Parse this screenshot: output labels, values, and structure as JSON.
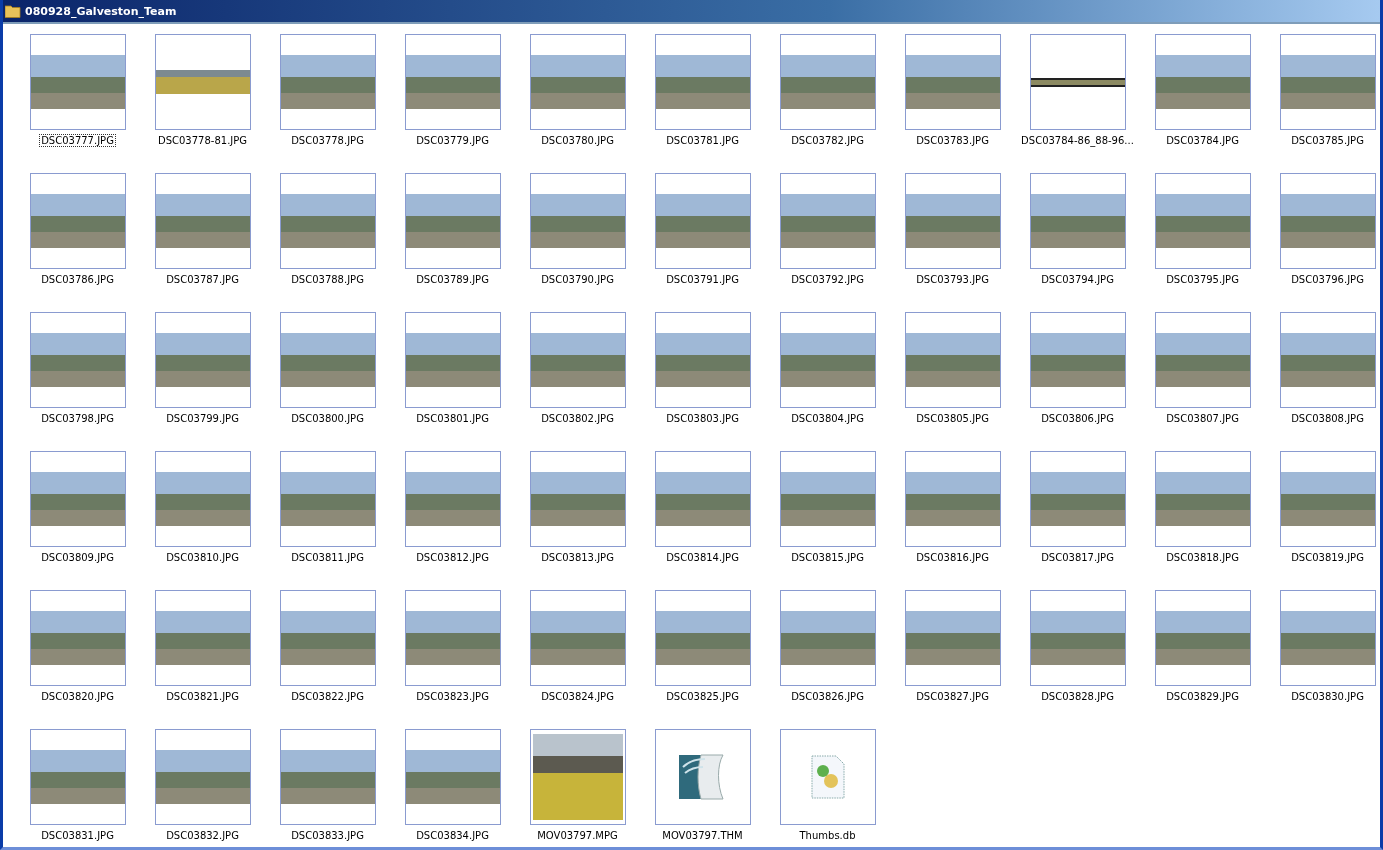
{
  "window": {
    "title": "080928_Galveston_Team"
  },
  "items": [
    {
      "name": "DSC03777.JPG",
      "kind": "photo",
      "focused": true
    },
    {
      "name": "DSC03778-81.JPG",
      "kind": "wide",
      "focused": false
    },
    {
      "name": "DSC03778.JPG",
      "kind": "photo",
      "focused": false
    },
    {
      "name": "DSC03779.JPG",
      "kind": "photo",
      "focused": false
    },
    {
      "name": "DSC03780.JPG",
      "kind": "photo",
      "focused": false
    },
    {
      "name": "DSC03781.JPG",
      "kind": "photo",
      "focused": false
    },
    {
      "name": "DSC03782.JPG",
      "kind": "photo",
      "focused": false
    },
    {
      "name": "DSC03783.JPG",
      "kind": "photo",
      "focused": false
    },
    {
      "name": "DSC03784-86_88-96...",
      "kind": "panorama",
      "focused": false
    },
    {
      "name": "DSC03784.JPG",
      "kind": "photo",
      "focused": false
    },
    {
      "name": "DSC03785.JPG",
      "kind": "photo",
      "focused": false
    },
    {
      "name": "DSC03786.JPG",
      "kind": "photo",
      "focused": false
    },
    {
      "name": "DSC03787.JPG",
      "kind": "photo",
      "focused": false
    },
    {
      "name": "DSC03788.JPG",
      "kind": "photo",
      "focused": false
    },
    {
      "name": "DSC03789.JPG",
      "kind": "photo",
      "focused": false
    },
    {
      "name": "DSC03790.JPG",
      "kind": "photo",
      "focused": false
    },
    {
      "name": "DSC03791.JPG",
      "kind": "photo",
      "focused": false
    },
    {
      "name": "DSC03792.JPG",
      "kind": "photo",
      "focused": false
    },
    {
      "name": "DSC03793.JPG",
      "kind": "photo",
      "focused": false
    },
    {
      "name": "DSC03794.JPG",
      "kind": "photo",
      "focused": false
    },
    {
      "name": "DSC03795.JPG",
      "kind": "photo",
      "focused": false
    },
    {
      "name": "DSC03796.JPG",
      "kind": "photo",
      "focused": false
    },
    {
      "name": "DSC03798.JPG",
      "kind": "photo",
      "focused": false
    },
    {
      "name": "DSC03799.JPG",
      "kind": "photo",
      "focused": false
    },
    {
      "name": "DSC03800.JPG",
      "kind": "photo",
      "focused": false
    },
    {
      "name": "DSC03801.JPG",
      "kind": "photo",
      "focused": false
    },
    {
      "name": "DSC03802.JPG",
      "kind": "photo",
      "focused": false
    },
    {
      "name": "DSC03803.JPG",
      "kind": "photo",
      "focused": false
    },
    {
      "name": "DSC03804.JPG",
      "kind": "photo",
      "focused": false
    },
    {
      "name": "DSC03805.JPG",
      "kind": "photo",
      "focused": false
    },
    {
      "name": "DSC03806.JPG",
      "kind": "photo",
      "focused": false
    },
    {
      "name": "DSC03807.JPG",
      "kind": "photo",
      "focused": false
    },
    {
      "name": "DSC03808.JPG",
      "kind": "photo",
      "focused": false
    },
    {
      "name": "DSC03809.JPG",
      "kind": "photo",
      "focused": false
    },
    {
      "name": "DSC03810.JPG",
      "kind": "photo",
      "focused": false
    },
    {
      "name": "DSC03811.JPG",
      "kind": "photo",
      "focused": false
    },
    {
      "name": "DSC03812.JPG",
      "kind": "photo",
      "focused": false
    },
    {
      "name": "DSC03813.JPG",
      "kind": "photo",
      "focused": false
    },
    {
      "name": "DSC03814.JPG",
      "kind": "photo",
      "focused": false
    },
    {
      "name": "DSC03815.JPG",
      "kind": "photo",
      "focused": false
    },
    {
      "name": "DSC03816.JPG",
      "kind": "photo",
      "focused": false
    },
    {
      "name": "DSC03817.JPG",
      "kind": "photo",
      "focused": false
    },
    {
      "name": "DSC03818.JPG",
      "kind": "photo",
      "focused": false
    },
    {
      "name": "DSC03819.JPG",
      "kind": "photo",
      "focused": false
    },
    {
      "name": "DSC03820.JPG",
      "kind": "photo",
      "focused": false
    },
    {
      "name": "DSC03821.JPG",
      "kind": "photo",
      "focused": false
    },
    {
      "name": "DSC03822.JPG",
      "kind": "photo",
      "focused": false
    },
    {
      "name": "DSC03823.JPG",
      "kind": "photo",
      "focused": false
    },
    {
      "name": "DSC03824.JPG",
      "kind": "photo",
      "focused": false
    },
    {
      "name": "DSC03825.JPG",
      "kind": "photo",
      "focused": false
    },
    {
      "name": "DSC03826.JPG",
      "kind": "photo",
      "focused": false
    },
    {
      "name": "DSC03827.JPG",
      "kind": "photo",
      "focused": false
    },
    {
      "name": "DSC03828.JPG",
      "kind": "photo",
      "focused": false
    },
    {
      "name": "DSC03829.JPG",
      "kind": "photo",
      "focused": false
    },
    {
      "name": "DSC03830.JPG",
      "kind": "photo",
      "focused": false
    },
    {
      "name": "DSC03831.JPG",
      "kind": "photo",
      "focused": false
    },
    {
      "name": "DSC03832.JPG",
      "kind": "photo",
      "focused": false
    },
    {
      "name": "DSC03833.JPG",
      "kind": "photo",
      "focused": false
    },
    {
      "name": "DSC03834.JPG",
      "kind": "photo",
      "focused": false
    },
    {
      "name": "MOV03797.MPG",
      "kind": "video",
      "focused": false
    },
    {
      "name": "MOV03797.THM",
      "kind": "app",
      "focused": false
    },
    {
      "name": "Thumbs.db",
      "kind": "file",
      "focused": false
    }
  ]
}
